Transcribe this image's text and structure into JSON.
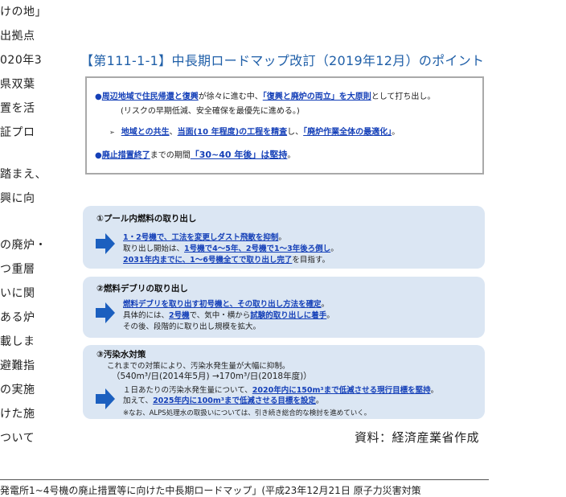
{
  "left_column": [
    "けの地」",
    "出拠点",
    "020年3",
    "県双葉",
    "置を活",
    "証プロ",
    "",
    "踏まえ、",
    "興に向",
    "",
    "の廃炉・",
    "つ重層",
    "いに関",
    "ある炉",
    "載しま",
    "避難指",
    "の実施",
    "けた施",
    "ついて"
  ],
  "figure_title": "【第111-1-1】中長期ロードマップ改訂（2019年12月）のポイント",
  "box1": {
    "line1": {
      "p1": "周辺地域で住民帰還と復興",
      "p2": "が徐々に進む中、",
      "p3": "「復興と廃炉の両立」を大原則",
      "p4": "として打ち出し。"
    },
    "line1_sub": "(リスクの早期低減、安全確保を最優先に進める。)",
    "line2": {
      "p1": "地域との共生",
      "p2": "、",
      "p3": "当面(10 年程度)の工程を精査",
      "p4": "し、",
      "p5": "「廃炉作業全体の最適化」",
      "p6": "。"
    },
    "line3": {
      "p1": "廃止措置終了",
      "p2": "までの期間",
      "p3": "「30~40 年後」は堅持",
      "p4": "。"
    }
  },
  "panels": [
    {
      "title": "①プール内燃料の取り出し",
      "l1": {
        "p1": "1・2号機で、工法を変更しダスト飛散を抑制",
        "p2": "。"
      },
      "l2": {
        "p1": "取り出し開始は、",
        "p2": "1号機で4～5年、2号機で1～3年後ろ倒し",
        "p3": "。"
      },
      "l3": {
        "p1": "2031年内までに、1～6号機全てで取り出し完了",
        "p2": "を目指す。"
      }
    },
    {
      "title": "②燃料デブリの取り出し",
      "l1": {
        "p1": "燃料デブリを取り出す初号機と、その取り出し方法を確定",
        "p2": "。"
      },
      "l2": {
        "p1": "具体的には、",
        "p2": "2号機",
        "p3": "で、気中・横から",
        "p4": "試験的取り出しに着手",
        "p5": "。"
      },
      "l3": {
        "p1": "その後、段階的に取り出し規模を拡大。"
      }
    },
    {
      "title": "③汚染水対策",
      "l0": "これまでの対策により、汚染水発生量が大幅に抑制。",
      "l0b": "（540m³/日(2014年5月) →170m³/日(2018年度)）",
      "l1": {
        "p1": "１日あたりの汚染水発生量について、",
        "p2": "2020年内に150m³まで低減させる現行目標を堅持",
        "p3": "。"
      },
      "l2": {
        "p1": "加えて、",
        "p2": "2025年内に100m³まで低減させる目標を設定",
        "p3": "。"
      },
      "l3": {
        "p1": "※なお、ALPS処理水の取扱いについては、引き続き総合的な検討を進めていく。"
      }
    }
  ],
  "source": "資料：経済産業省作成",
  "footnote": "発電所1~4号機の廃止措置等に向けた中長期ロードマップ」(平成23年12月21日 原子力災害対策",
  "colors": {
    "title": "#1f5fa8",
    "accent": "#1540b8",
    "panel_bg": "#dbe6f3",
    "arrow": "#1b5fbf"
  },
  "icons": {
    "arrow": "right-arrow-icon",
    "bullet": "circle-bullet-icon",
    "chevron": "triangle-bullet-icon"
  }
}
